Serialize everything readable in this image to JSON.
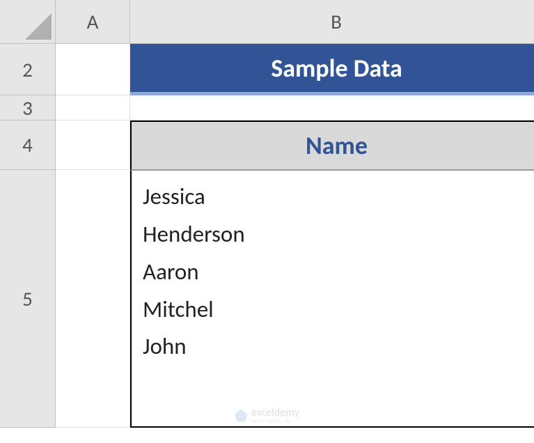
{
  "columns": [
    "A",
    "B"
  ],
  "rows": [
    "2",
    "3",
    "4",
    "5"
  ],
  "title": "Sample Data",
  "table": {
    "header": "Name",
    "values": [
      "Jessica",
      "Henderson",
      "Aaron",
      "Mitchel",
      "John"
    ]
  },
  "watermark": {
    "brand": "exceldemy",
    "tagline": "EXCEL · DATA · BI"
  }
}
